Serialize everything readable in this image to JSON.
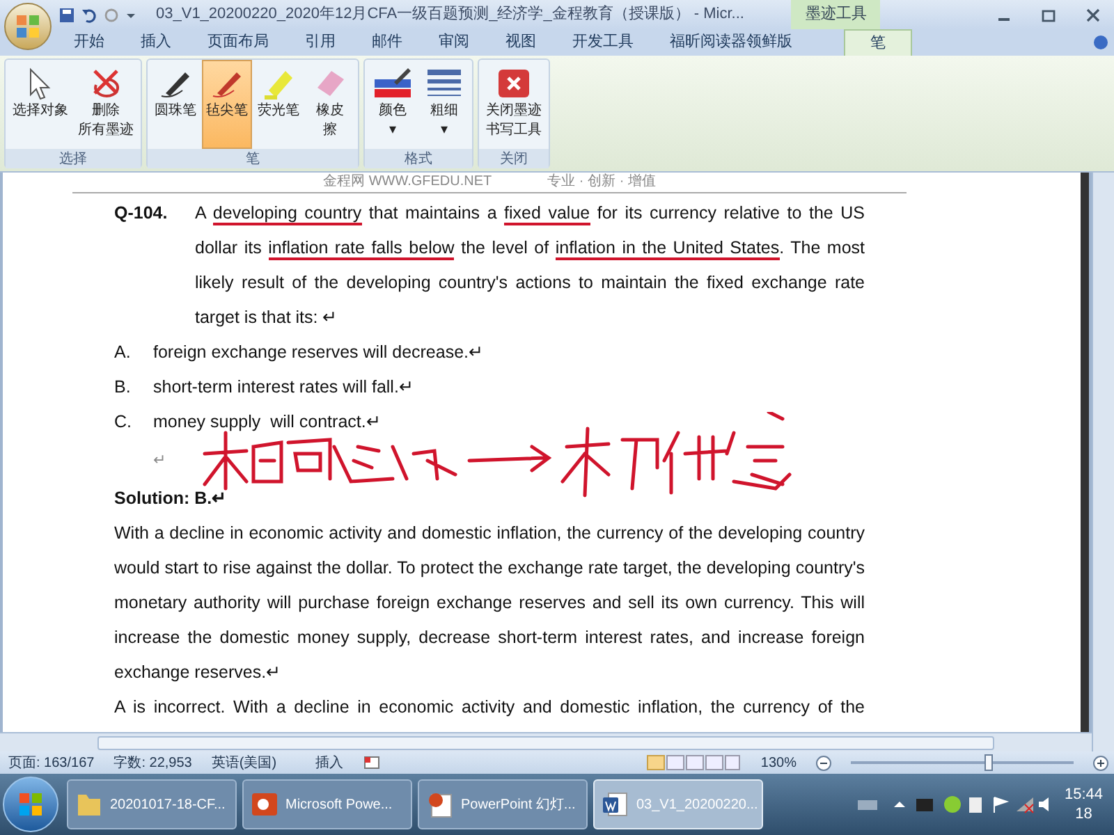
{
  "window": {
    "title": "03_V1_20200220_2020年12月CFA一级百题预测_经济学_金程教育（授课版） - Micr...",
    "context_tab_group": "墨迹工具"
  },
  "tabs": [
    {
      "label": "开始",
      "selected": false
    },
    {
      "label": "插入",
      "selected": false
    },
    {
      "label": "页面布局",
      "selected": false
    },
    {
      "label": "引用",
      "selected": false
    },
    {
      "label": "邮件",
      "selected": false
    },
    {
      "label": "审阅",
      "selected": false
    },
    {
      "label": "视图",
      "selected": false
    },
    {
      "label": "开发工具",
      "selected": false
    },
    {
      "label": "福昕阅读器领鲜版",
      "selected": false
    },
    {
      "label": "笔",
      "selected": true
    }
  ],
  "ribbon_groups": [
    {
      "label": "选择",
      "buttons": [
        {
          "lines": [
            "选择对象"
          ],
          "kind": "cursor",
          "selected": false
        },
        {
          "lines": [
            "删除",
            "所有墨迹"
          ],
          "kind": "erase-all",
          "selected": false
        }
      ]
    },
    {
      "label": "笔",
      "buttons": [
        {
          "lines": [
            "圆珠笔"
          ],
          "kind": "pen",
          "selected": false
        },
        {
          "lines": [
            "毡尖笔"
          ],
          "kind": "felt",
          "selected": true
        },
        {
          "lines": [
            "荧光笔"
          ],
          "kind": "highlighter",
          "selected": false
        },
        {
          "lines": [
            "橡皮",
            "擦"
          ],
          "kind": "eraser",
          "selected": false
        }
      ]
    },
    {
      "label": "格式",
      "buttons": [
        {
          "lines": [
            "颜色",
            "▾"
          ],
          "kind": "color",
          "selected": false
        },
        {
          "lines": [
            "粗细",
            "▾"
          ],
          "kind": "weight",
          "selected": false
        }
      ]
    },
    {
      "label": "关闭",
      "buttons": [
        {
          "lines": [
            "关闭墨迹",
            "书写工具"
          ],
          "kind": "close",
          "selected": false
        }
      ]
    }
  ],
  "document": {
    "header_left": "金程网 WWW.GFEDU.NET",
    "header_right": "专业 · 创新 · 增值",
    "question_number": "Q-104.",
    "question": [
      {
        "text": "A ",
        "ink_underline": false
      },
      {
        "text": "developing country",
        "ink_underline": true
      },
      {
        "text": " that maintains a ",
        "ink_underline": false
      },
      {
        "text": "fixed value",
        "ink_underline": true
      },
      {
        "text": " for its currency relative to the US dollar its ",
        "ink_underline": false
      },
      {
        "text": "inflation rate falls below",
        "ink_underline": true
      },
      {
        "text": " the level of ",
        "ink_underline": false
      },
      {
        "text": "inflation in the United States",
        "ink_underline": true
      },
      {
        "text": ". The most likely result of the developing country's actions to maintain the fixed exchange rate target is that its: ↵",
        "ink_underline": false
      }
    ],
    "options": [
      {
        "letter": "A.",
        "text": "foreign exchange reserves will decrease.↵"
      },
      {
        "letter": "B.",
        "text": "short-term interest rates will fall.↵"
      },
      {
        "letter": "C.",
        "text": "money supply  will contract.↵"
      }
    ],
    "empty_mark": "↵",
    "solution_title": "Solution: B.↵",
    "paragraphs": [
      {
        "kind": "full",
        "text": "With a decline in economic activity and domestic inflation, the currency of the developing country would start to rise against the dollar. To protect the exchange rate target, the developing country's monetary authority will purchase foreign exchange reserves and sell its own currency. This will increase the domestic money supply, decrease short-term interest rates, and increase foreign exchange reserves.↵"
      },
      {
        "kind": "cut-line",
        "text": "A is incorrect. With a decline in economic activity and domestic inflation, the currency of the"
      }
    ]
  },
  "status_bar": {
    "page": "页面: 163/167",
    "words": "字数: 22,953",
    "language": "英语(美国)",
    "mode": "插入",
    "zoom": "130%",
    "zoom_slider": {
      "level": 0.62
    }
  },
  "taskbar": {
    "items": [
      {
        "label": "20201017-18-CF...",
        "kind": "folder",
        "selected": false
      },
      {
        "label": "Microsoft Powe...",
        "kind": "powerpoint",
        "selected": false
      },
      {
        "label": "PowerPoint 幻灯...",
        "kind": "slideshow",
        "selected": false
      },
      {
        "label": "03_V1_20200220...",
        "kind": "word",
        "selected": true
      }
    ],
    "time": "15:44",
    "date": "18"
  }
}
